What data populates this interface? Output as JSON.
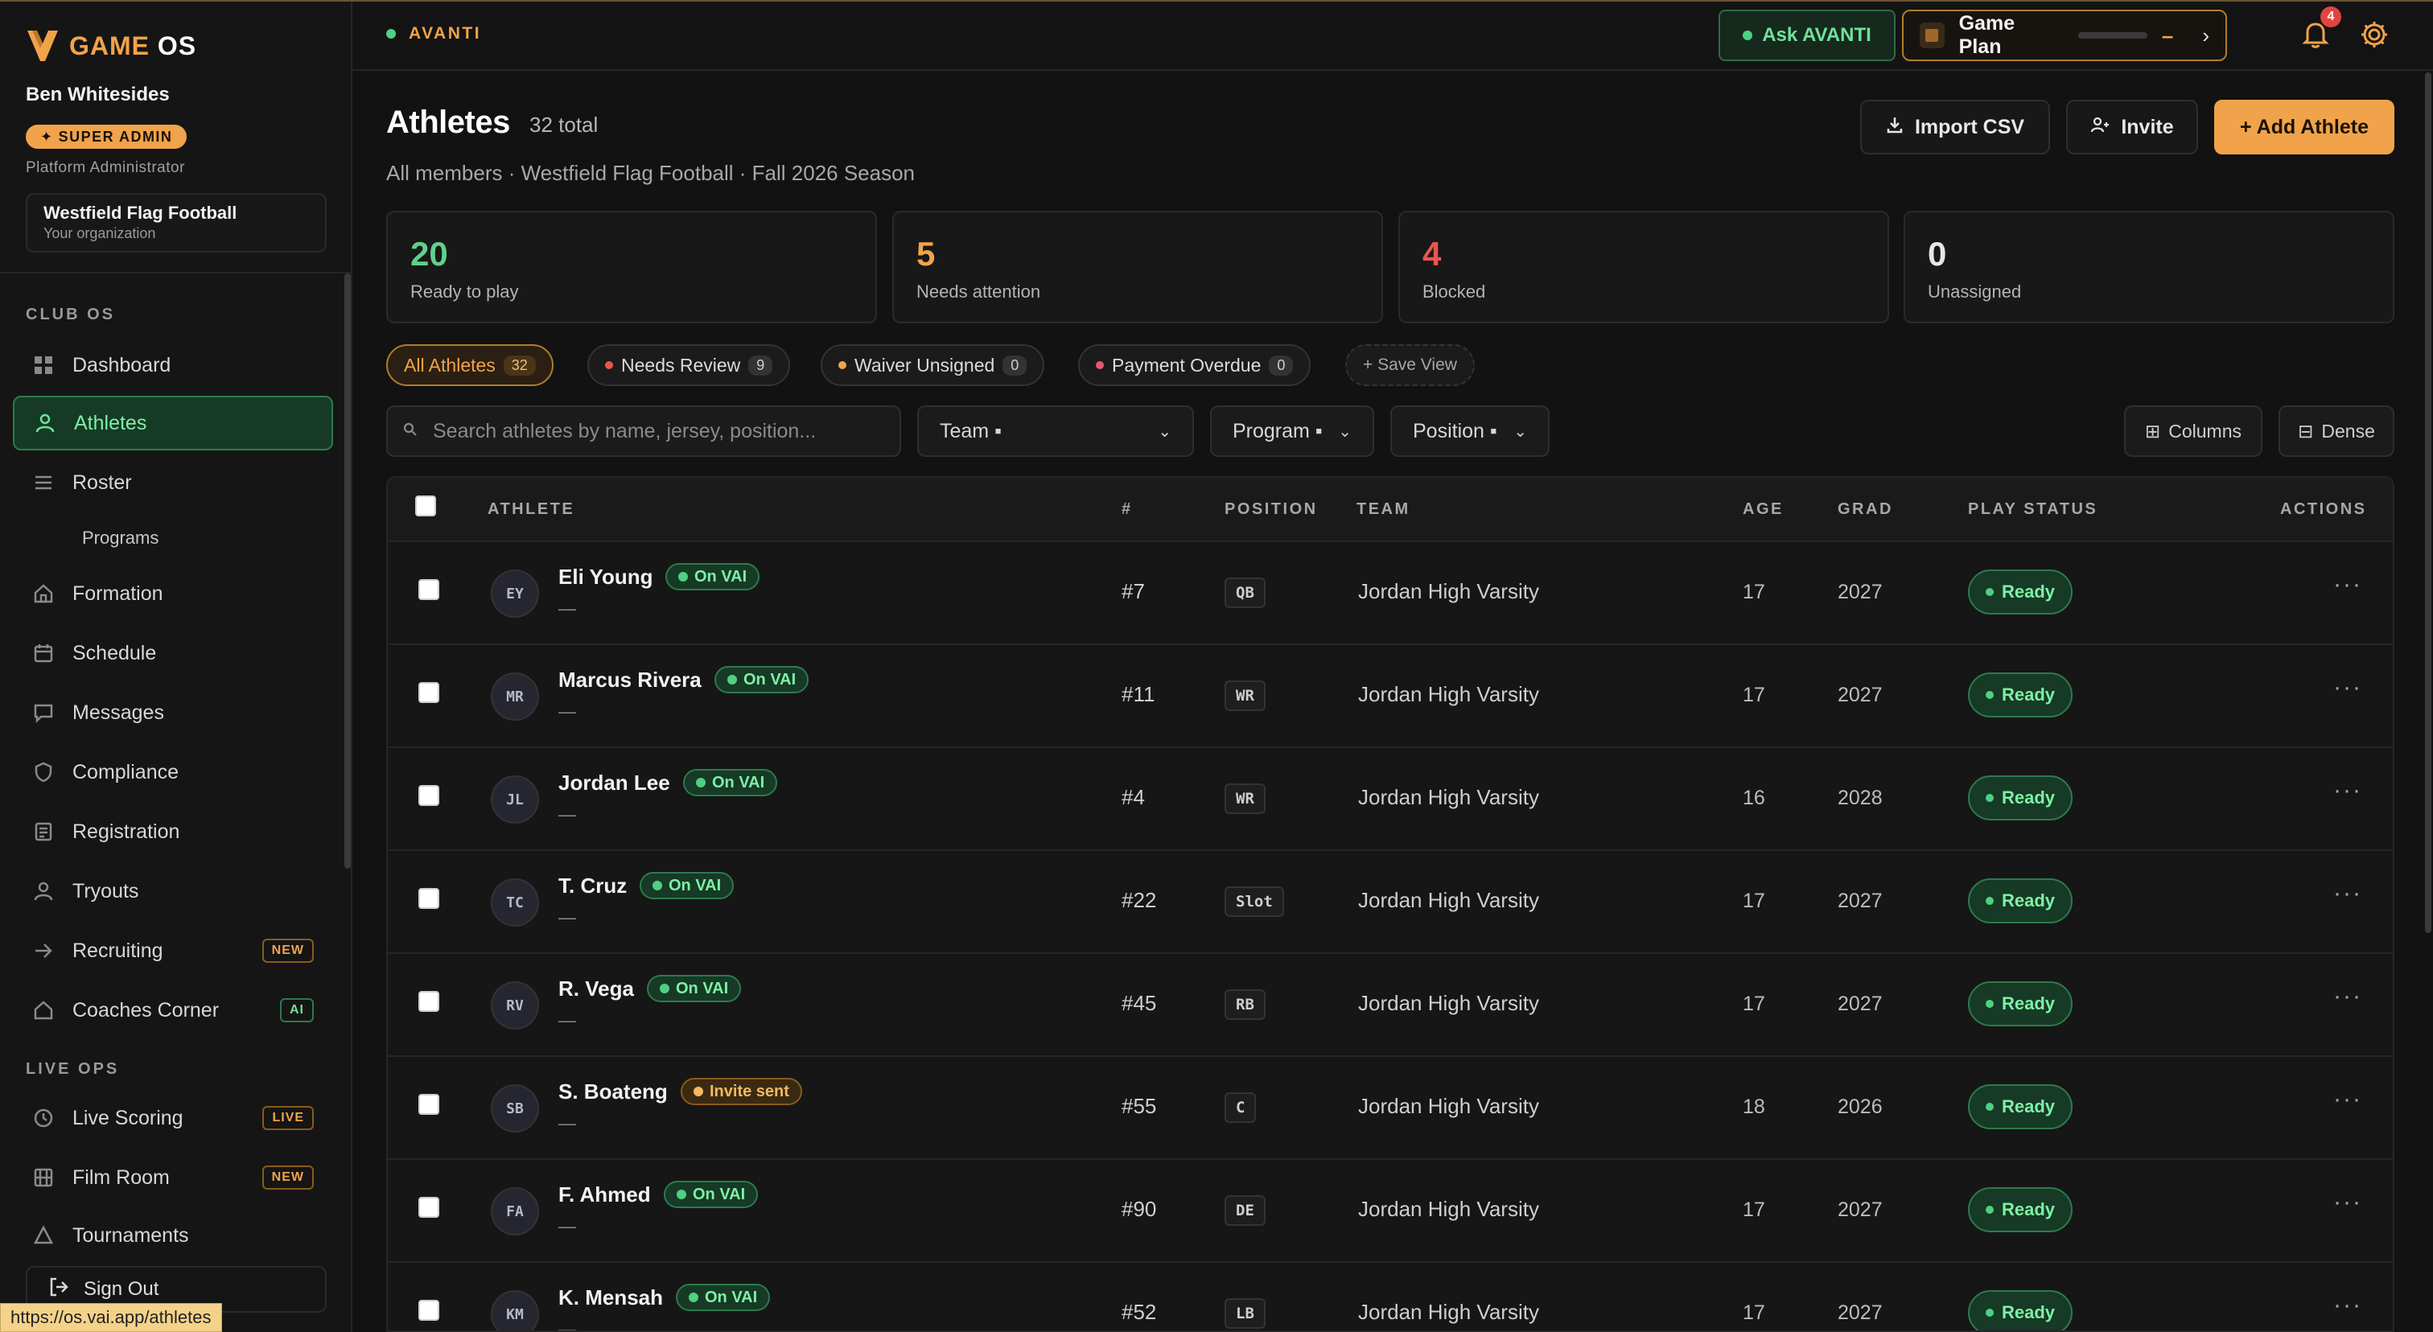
{
  "brand": {
    "name_a": "GAME",
    "name_b": " OS",
    "accent": "#f0a34a"
  },
  "user": {
    "name": "Ben Whitesides",
    "badge": "SUPER ADMIN",
    "role": "Platform Administrator"
  },
  "org": {
    "name": "Westfield Flag Football",
    "sub": "Your organization"
  },
  "sidebar": {
    "section_club": "CLUB OS",
    "section_live": "LIVE OPS",
    "items": [
      {
        "label": "Dashboard",
        "icon": "grid-icon"
      },
      {
        "label": "Athletes",
        "icon": "person-icon",
        "active": true
      },
      {
        "label": "Roster",
        "icon": "list-icon"
      },
      {
        "label": "Programs",
        "icon": ""
      },
      {
        "label": "Formation",
        "icon": "home-icon"
      },
      {
        "label": "Schedule",
        "icon": "calendar-icon"
      },
      {
        "label": "Messages",
        "icon": "message-icon"
      },
      {
        "label": "Compliance",
        "icon": "shield-icon"
      },
      {
        "label": "Registration",
        "icon": "form-icon"
      },
      {
        "label": "Tryouts",
        "icon": "person-icon"
      },
      {
        "label": "Recruiting",
        "icon": "arrow-right-icon",
        "tag": "NEW"
      },
      {
        "label": "Coaches Corner",
        "icon": "house-icon",
        "tag": "AI"
      },
      {
        "label": "Live Scoring",
        "icon": "clock-icon",
        "tag": "LIVE"
      },
      {
        "label": "Film Room",
        "icon": "film-icon",
        "tag": "NEW"
      },
      {
        "label": "Tournaments",
        "icon": "triangle-icon"
      }
    ],
    "signout": "Sign Out"
  },
  "url_tooltip": "https://os.vai.app/athletes",
  "topbar": {
    "context": "AVANTI",
    "ask": "Ask AVANTI",
    "gameplan": "Game Plan",
    "gameplan_dash": "–",
    "gameplan_chevron": "›",
    "notifications": "4"
  },
  "header": {
    "title": "Athletes",
    "count": "32 total",
    "subtitle": "All members · Westfield Flag Football · Fall 2026 Season",
    "import": "Import CSV",
    "invite": "Invite",
    "add": "+ Add Athlete"
  },
  "stats": [
    {
      "value": "20",
      "label": "Ready to play",
      "color": "#5fd18a"
    },
    {
      "value": "5",
      "label": "Needs attention",
      "color": "#f0a34a"
    },
    {
      "value": "4",
      "label": "Blocked",
      "color": "#e8564e"
    },
    {
      "value": "0",
      "label": "Unassigned",
      "color": "#e6e6e6"
    }
  ],
  "chips": [
    {
      "label": "All Athletes",
      "count": "32"
    },
    {
      "label": "Needs Review",
      "count": "9",
      "dot": "#e8564e"
    },
    {
      "label": "Waiver Unsigned",
      "count": "0",
      "dot": "#f0a34a"
    },
    {
      "label": "Payment Overdue",
      "count": "0",
      "dot": "#e8567a"
    },
    {
      "label": "+ Save View"
    }
  ],
  "filters": {
    "search_placeholder": "Search athletes by name, jersey, position...",
    "team": "Team ▪",
    "program": "Program ▪",
    "position": "Position ▪",
    "columns": "Columns",
    "dense": "Dense"
  },
  "table": {
    "headers": {
      "athlete": "ATHLETE",
      "jersey": "#",
      "position": "POSITION",
      "team": "TEAM",
      "age": "AGE",
      "grad": "GRAD",
      "status": "PLAY STATUS",
      "actions": "ACTIONS"
    },
    "rows": [
      {
        "initials": "EY",
        "name": "Eli Young",
        "tag": "On VAI",
        "tag_type": "green",
        "sub": "—",
        "jersey": "#7",
        "position": "QB",
        "team": "Jordan High Varsity",
        "age": "17",
        "grad": "2027",
        "status": "Ready"
      },
      {
        "initials": "MR",
        "name": "Marcus Rivera",
        "tag": "On VAI",
        "tag_type": "green",
        "sub": "—",
        "jersey": "#11",
        "position": "WR",
        "team": "Jordan High Varsity",
        "age": "17",
        "grad": "2027",
        "status": "Ready"
      },
      {
        "initials": "JL",
        "name": "Jordan Lee",
        "tag": "On VAI",
        "tag_type": "green",
        "sub": "—",
        "jersey": "#4",
        "position": "WR",
        "team": "Jordan High Varsity",
        "age": "16",
        "grad": "2028",
        "status": "Ready"
      },
      {
        "initials": "TC",
        "name": "T. Cruz",
        "tag": "On VAI",
        "tag_type": "green",
        "sub": "—",
        "jersey": "#22",
        "position": "Slot",
        "team": "Jordan High Varsity",
        "age": "17",
        "grad": "2027",
        "status": "Ready"
      },
      {
        "initials": "RV",
        "name": "R. Vega",
        "tag": "On VAI",
        "tag_type": "green",
        "sub": "—",
        "jersey": "#45",
        "position": "RB",
        "team": "Jordan High Varsity",
        "age": "17",
        "grad": "2027",
        "status": "Ready"
      },
      {
        "initials": "SB",
        "name": "S. Boateng",
        "tag": "Invite sent",
        "tag_type": "amber",
        "sub": "—",
        "jersey": "#55",
        "position": "C",
        "team": "Jordan High Varsity",
        "age": "18",
        "grad": "2026",
        "status": "Ready"
      },
      {
        "initials": "FA",
        "name": "F. Ahmed",
        "tag": "On VAI",
        "tag_type": "green",
        "sub": "—",
        "jersey": "#90",
        "position": "DE",
        "team": "Jordan High Varsity",
        "age": "17",
        "grad": "2027",
        "status": "Ready"
      },
      {
        "initials": "KM",
        "name": "K. Mensah",
        "tag": "On VAI",
        "tag_type": "green",
        "sub": "—",
        "jersey": "#52",
        "position": "LB",
        "team": "Jordan High Varsity",
        "age": "17",
        "grad": "2027",
        "status": "Ready"
      }
    ]
  }
}
